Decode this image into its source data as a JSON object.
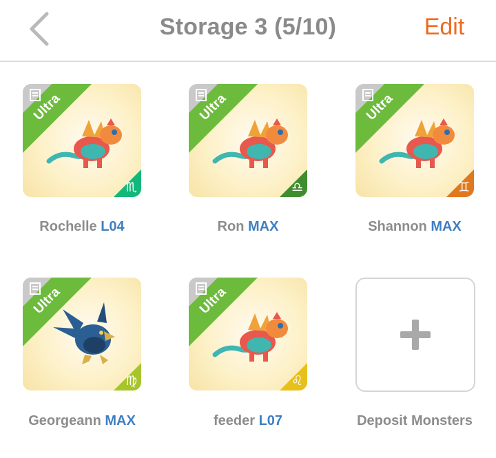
{
  "header": {
    "title": "Storage 3 (5/10)",
    "edit_label": "Edit"
  },
  "slots": [
    {
      "name": "Rochelle",
      "level": "L04",
      "rarity": "Ultra",
      "zodiac_glyph": "♏",
      "zodiac_color": "#12b87a",
      "monster": "dragon-icon"
    },
    {
      "name": "Ron",
      "level": "MAX",
      "rarity": "Ultra",
      "zodiac_glyph": "♎",
      "zodiac_color": "#3f8d2e",
      "monster": "dragon-icon"
    },
    {
      "name": "Shannon",
      "level": "MAX",
      "rarity": "Ultra",
      "zodiac_glyph": "♊",
      "zodiac_color": "#e0781e",
      "monster": "dragon-icon"
    },
    {
      "name": "Georgeann",
      "level": "MAX",
      "rarity": "Ultra",
      "zodiac_glyph": "♍",
      "zodiac_color": "#a6c52b",
      "monster": "bird-dragon-icon"
    },
    {
      "name": "feeder",
      "level": "L07",
      "rarity": "Ultra",
      "zodiac_glyph": "♌",
      "zodiac_color": "#e8c01c",
      "monster": "dragon-icon"
    }
  ],
  "deposit": {
    "label": "Deposit Monsters",
    "icon": "plus-icon"
  },
  "colors": {
    "accent": "#ee6a1f",
    "level_text": "#3f7fc1",
    "ultra_ribbon": "#6dbb3c"
  }
}
